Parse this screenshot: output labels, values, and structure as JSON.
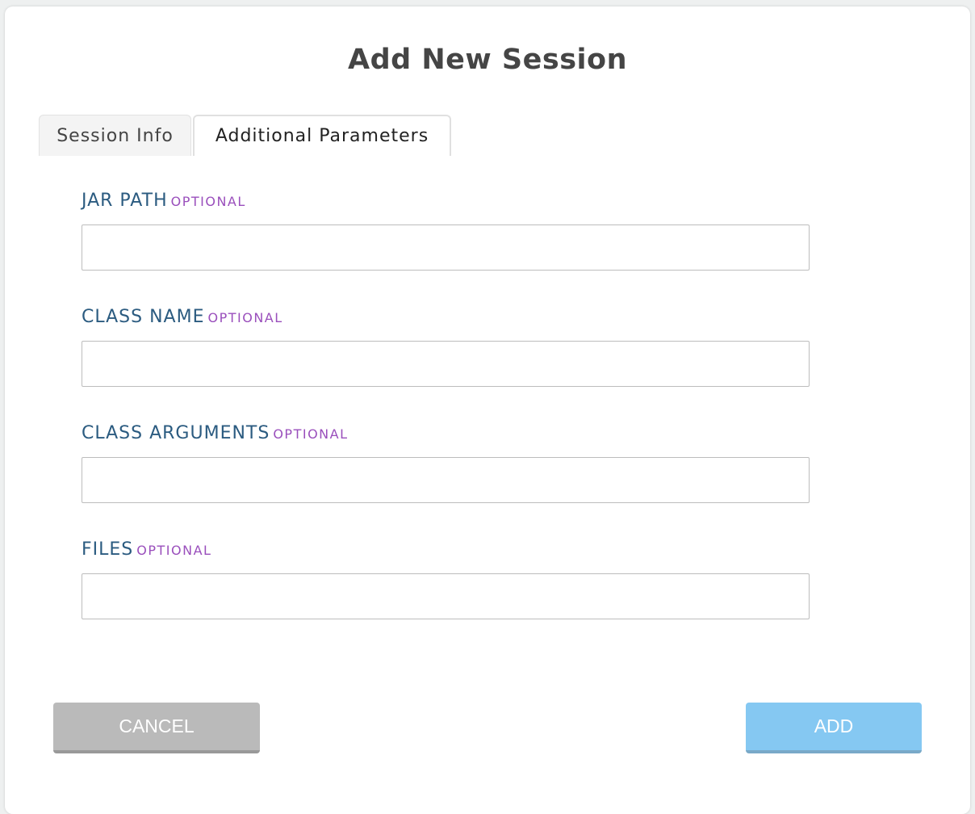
{
  "dialog": {
    "title": "Add New Session",
    "tabs": [
      {
        "label": "Session Info",
        "active": false
      },
      {
        "label": "Additional Parameters",
        "active": true
      }
    ],
    "fields": [
      {
        "label": "JAR PATH",
        "optional": "OPTIONAL",
        "value": ""
      },
      {
        "label": "CLASS NAME",
        "optional": "OPTIONAL",
        "value": ""
      },
      {
        "label": "CLASS ARGUMENTS",
        "optional": "OPTIONAL",
        "value": ""
      },
      {
        "label": "FILES",
        "optional": "OPTIONAL",
        "value": ""
      }
    ],
    "cancel_label": "CANCEL",
    "add_label": "ADD"
  },
  "colors": {
    "label": "#2b5b80",
    "optional": "#9a4fbc",
    "cancel": "#bababa",
    "add": "#85c8f2"
  }
}
